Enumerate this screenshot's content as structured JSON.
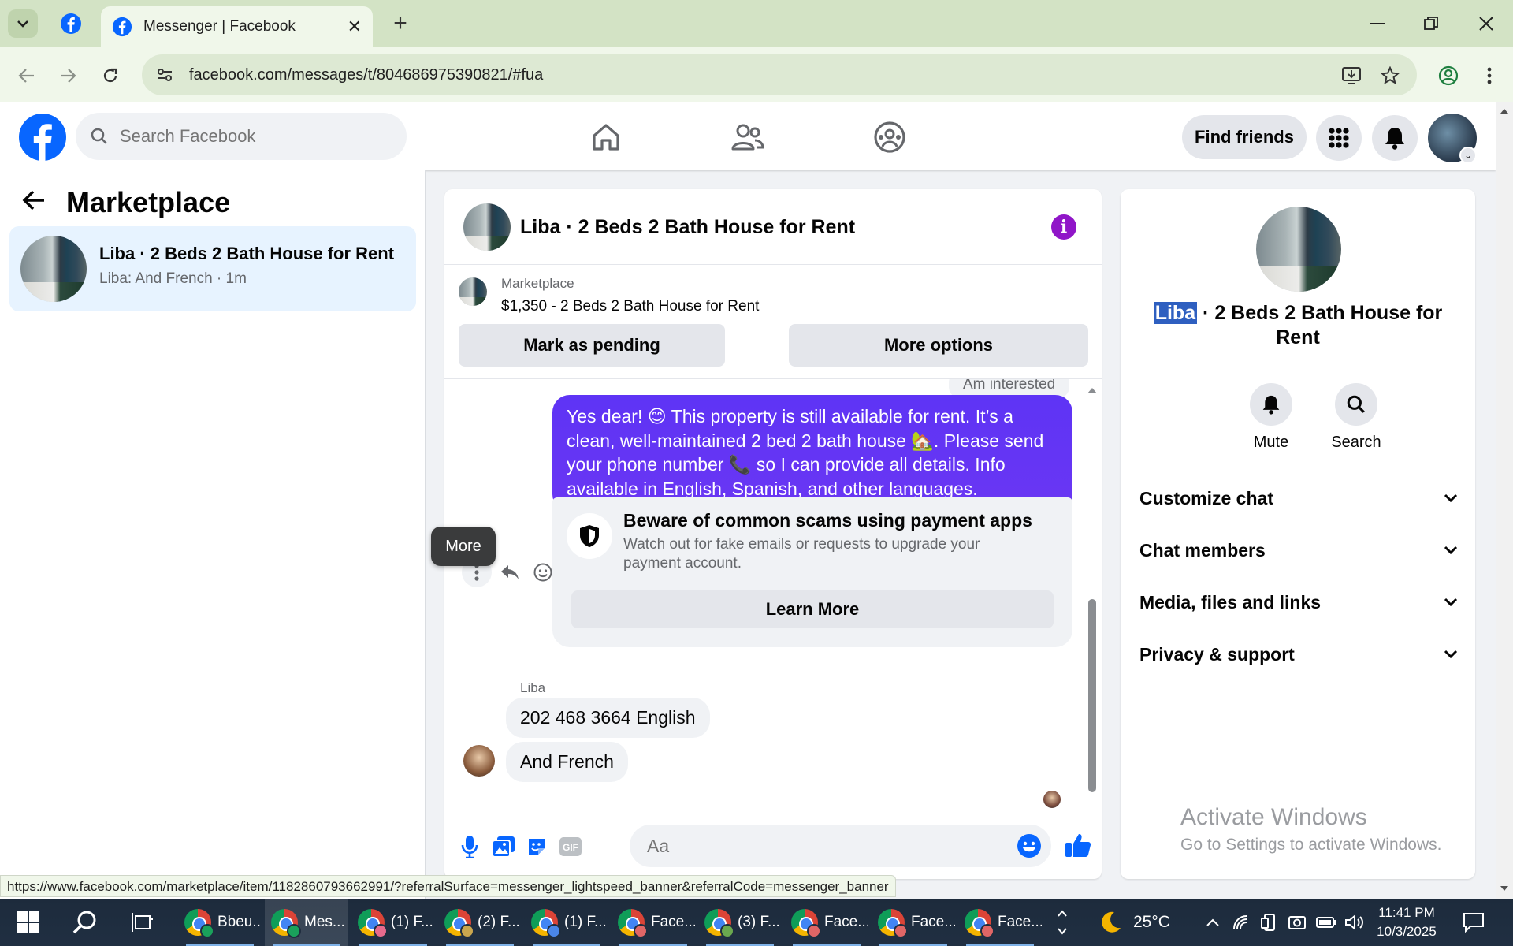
{
  "browser": {
    "tab_title": "Messenger | Facebook",
    "url": "facebook.com/messages/t/804686975390821/#fua",
    "status_url": "https://www.facebook.com/marketplace/item/1182860793662991/?referralSurface=messenger_lightspeed_banner&referralCode=messenger_banner"
  },
  "header": {
    "search_placeholder": "Search Facebook",
    "find_friends": "Find friends"
  },
  "left": {
    "title": "Marketplace",
    "conversation": {
      "name": "Liba · 2 Beds 2 Bath House for Rent",
      "preview": "Liba: And French · 1m"
    }
  },
  "chat": {
    "title": "Liba · 2 Beds 2 Bath House for Rent",
    "marketplace_label": "Marketplace",
    "listing": "$1,350 - 2 Beds 2 Bath House for Rent",
    "mark_pending": "Mark as pending",
    "more_options": "More options",
    "prev_message": "Am interested",
    "outgoing": "Yes dear! 😊 This property is still available for rent. It’s a clean, well-maintained 2 bed 2 bath house 🏡. Please send your phone number 📞 so I can provide all details. Info available in English, Spanish, and other languages.",
    "scam_title": "Beware of common scams using payment apps",
    "scam_body": "Watch out for fake emails or requests to upgrade your payment account.",
    "learn_more": "Learn More",
    "sender": "Liba",
    "msg1": "202 468 3664 English",
    "msg2": "And French",
    "composer_placeholder": "Aa",
    "tooltip": "More"
  },
  "right": {
    "title_highlight": "Liba",
    "title_rest": " · 2 Beds 2 Bath House for Rent",
    "mute": "Mute",
    "search": "Search",
    "sections": [
      "Customize chat",
      "Chat members",
      "Media, files and links",
      "Privacy & support"
    ],
    "activate_title": "Activate Windows",
    "activate_sub": "Go to Settings to activate Windows."
  },
  "taskbar": {
    "apps": [
      "Bbeu...",
      "Mes...",
      "(1) F...",
      "(2) F...",
      "(1) F...",
      "Face...",
      "(3) F...",
      "Face...",
      "Face...",
      "Face..."
    ],
    "temperature": "25°C",
    "time": "11:41 PM",
    "date": "10/3/2025"
  },
  "colors": {
    "fb_blue": "#0866ff",
    "messenger_purple": "#6a36f3",
    "info_purple": "#9016c8"
  }
}
